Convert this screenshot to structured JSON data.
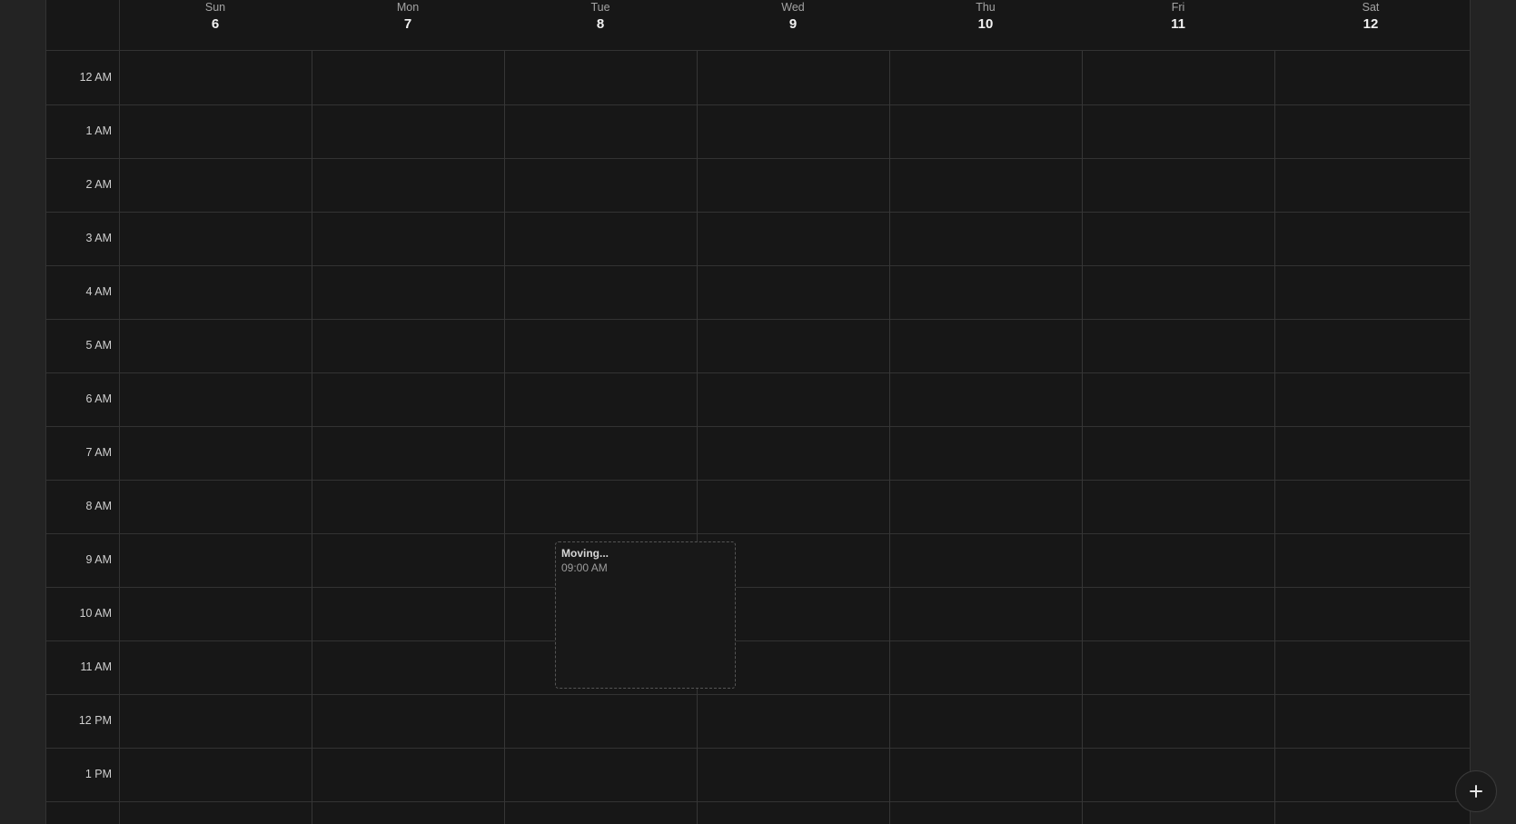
{
  "week": {
    "days": [
      {
        "name": "Sun",
        "date": "6"
      },
      {
        "name": "Mon",
        "date": "7"
      },
      {
        "name": "Tue",
        "date": "8"
      },
      {
        "name": "Wed",
        "date": "9"
      },
      {
        "name": "Thu",
        "date": "10"
      },
      {
        "name": "Fri",
        "date": "11"
      },
      {
        "name": "Sat",
        "date": "12"
      }
    ]
  },
  "hours": [
    "12 AM",
    "1 AM",
    "2 AM",
    "3 AM",
    "4 AM",
    "5 AM",
    "6 AM",
    "7 AM",
    "8 AM",
    "9 AM",
    "10 AM",
    "11 AM",
    "12 PM",
    "1 PM"
  ],
  "drag_event": {
    "title": "Moving...",
    "time": "09:00 AM",
    "day": "Tue",
    "start_hour": "9 AM"
  },
  "fab": {
    "icon": "plus-icon"
  },
  "colors": {
    "background": "#171717",
    "outer": "#232323",
    "grid_line": "#333333",
    "text_primary": "#f2f2f2",
    "text_secondary": "#a3a3a3"
  }
}
